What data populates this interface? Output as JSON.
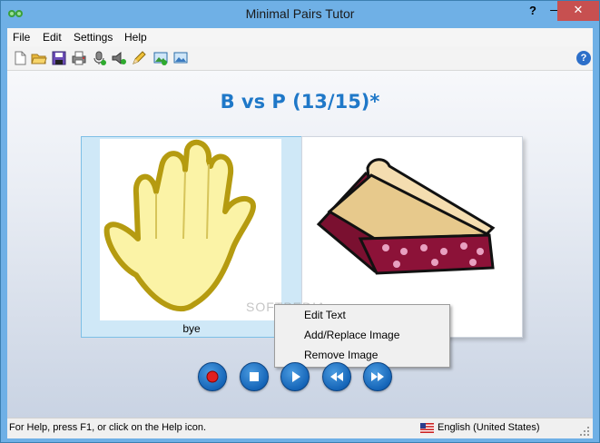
{
  "window": {
    "title": "Minimal Pairs Tutor"
  },
  "titlebar": {
    "help_label": "?",
    "minimize_label": "—",
    "close_label": "✕"
  },
  "menu": {
    "items": [
      "File",
      "Edit",
      "Settings",
      "Help"
    ]
  },
  "toolbar": {
    "icons": [
      "new-file-icon",
      "open-folder-icon",
      "save-icon",
      "print-icon",
      "microphone-icon",
      "speaker-icon",
      "pencil-icon",
      "import-image-icon",
      "image-icon"
    ],
    "help_label": "?"
  },
  "main": {
    "heading": "B vs P (13/15)*",
    "left_card": {
      "caption": "bye",
      "image": "hand-icon"
    },
    "right_card": {
      "image": "pie-icon"
    },
    "watermark": "SOFTPEDIA"
  },
  "context_menu": {
    "items": [
      "Edit Text",
      "Add/Replace Image",
      "Remove Image"
    ]
  },
  "controls": [
    "record-button",
    "stop-button",
    "play-button",
    "rewind-button",
    "forward-button"
  ],
  "status": {
    "help_text": "For Help, press F1, or click on the Help icon.",
    "language": "English (United States)"
  },
  "colors": {
    "accent": "#1f78c8",
    "titlebar": "#6fb0e6",
    "close": "#c75050",
    "record": "#e02020"
  }
}
